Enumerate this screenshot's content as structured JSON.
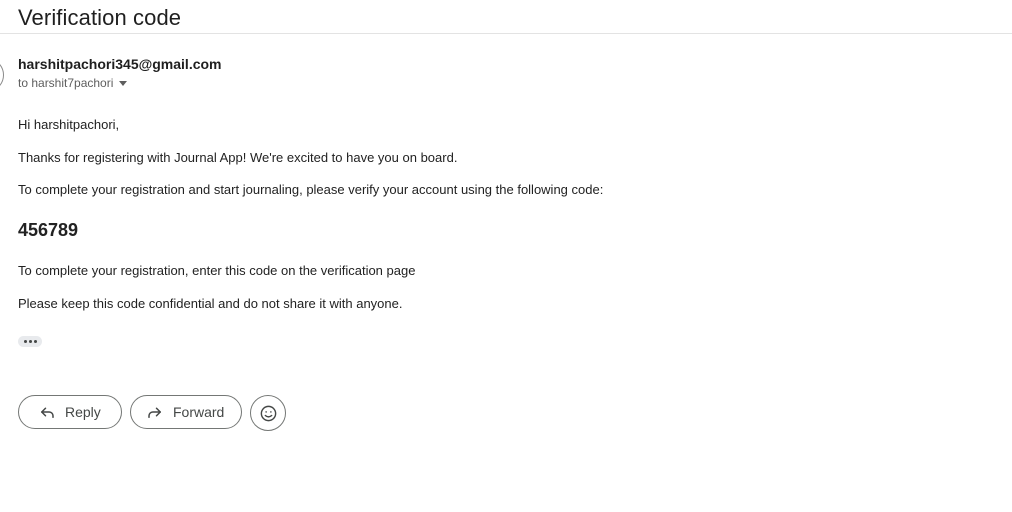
{
  "email": {
    "subject": "Verification code",
    "sender": "harshitpachori345@gmail.com",
    "recipient": "to harshit7pachori",
    "body": {
      "greeting": "Hi harshitpachori,",
      "line1": "Thanks for registering with Journal App! We're excited to have you on board.",
      "line2": "To complete your registration and start journaling, please verify your account using the following code:",
      "code": "456789",
      "line3": "To complete your registration, enter this code on the verification page",
      "line4": "Please keep this code confidential and do not share it with anyone."
    }
  },
  "actions": {
    "reply_label": "Reply",
    "forward_label": "Forward"
  },
  "icons": {
    "recipient_toggle": "caret-down-icon",
    "trimmed_content": "more-horizontal-icon",
    "reply": "reply-arrow-icon",
    "forward": "forward-arrow-icon",
    "emoji": "smiley-icon"
  },
  "colors": {
    "text": "#1f1f1f",
    "secondary_text": "#5e5e5e",
    "button_border": "#747775",
    "divider": "#e3e3e3"
  }
}
